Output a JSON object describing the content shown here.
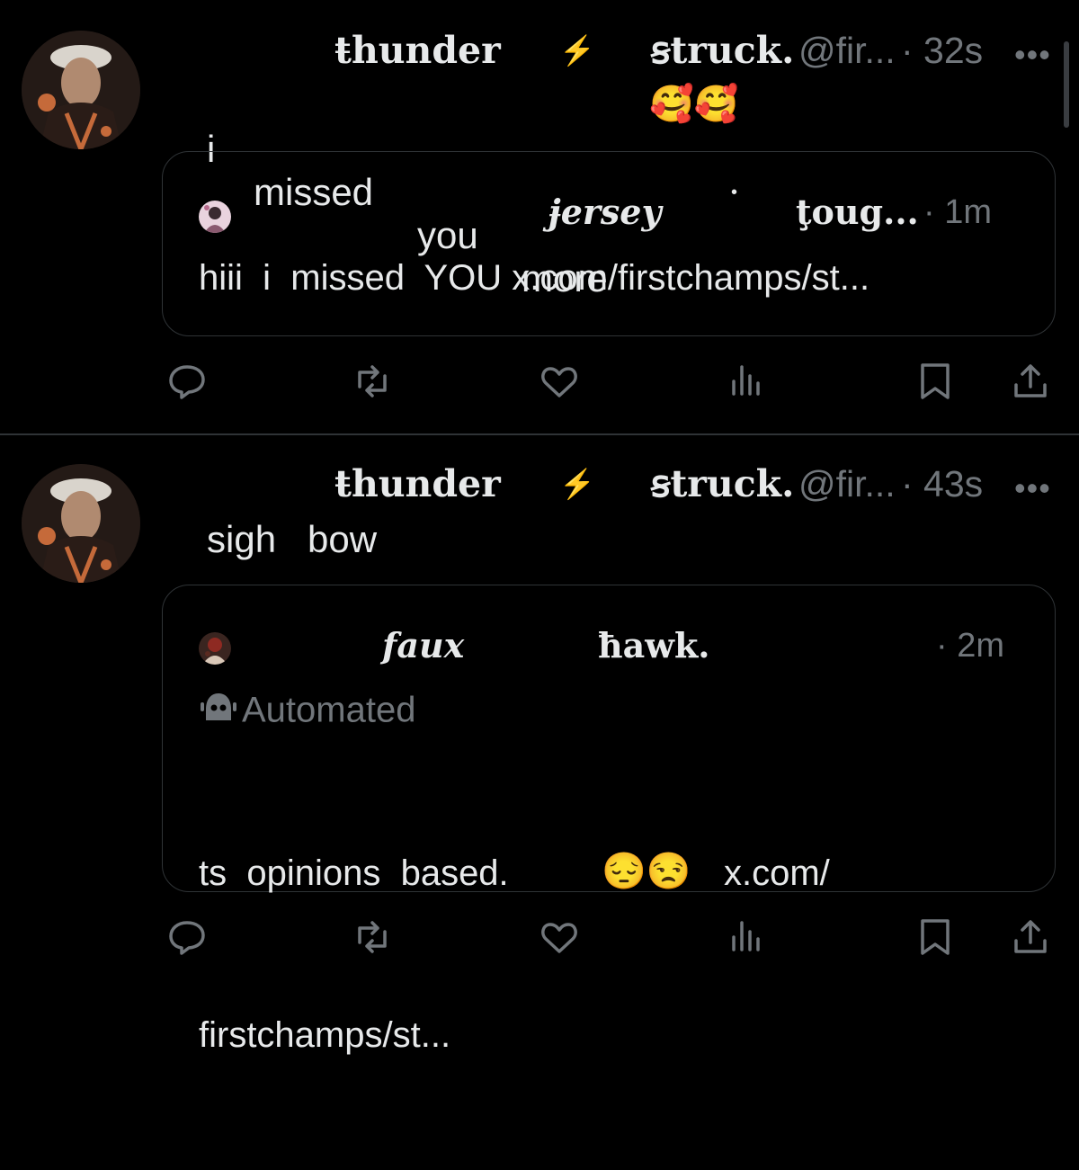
{
  "tweets": [
    {
      "author_part1": "ŧhunder",
      "author_bolt": "⚡",
      "author_part2": "ꞩtruck.",
      "handle": "@fir...",
      "time": "· 32s",
      "more": "•••",
      "text_words": [
        "i",
        "missed",
        "you",
        "more"
      ],
      "emojis": "🥰🥰",
      "quote": {
        "author_part1": "ɉersey",
        "author_sep": "˙",
        "author_part2": "ţoug...",
        "time": "· 1m",
        "text": "hiii  i  missed  YOU x.com/firstchamps/st..."
      }
    },
    {
      "author_part1": "ŧhunder",
      "author_bolt": "⚡",
      "author_part2": "ꞩtruck.",
      "handle": "@fir...",
      "time": "· 43s",
      "more": "•••",
      "text": "sigh   bow",
      "quote": {
        "author_part1": "faux",
        "author_part2": "ħawk.",
        "time": "· 2m",
        "automated_label": "Automated",
        "text_line1": "ts  opinions  based.",
        "emojis": "😔😒",
        "text_link": "x.com/",
        "text_line2": "firstchamps/st..."
      }
    }
  ],
  "actions": {
    "icons": [
      "reply-icon",
      "retweet-icon",
      "like-icon",
      "views-icon",
      "bookmark-icon",
      "share-icon"
    ]
  },
  "colors": {
    "background": "#000000",
    "text_primary": "#e7e9ea",
    "text_secondary": "#71767b",
    "border": "#2f3336"
  }
}
